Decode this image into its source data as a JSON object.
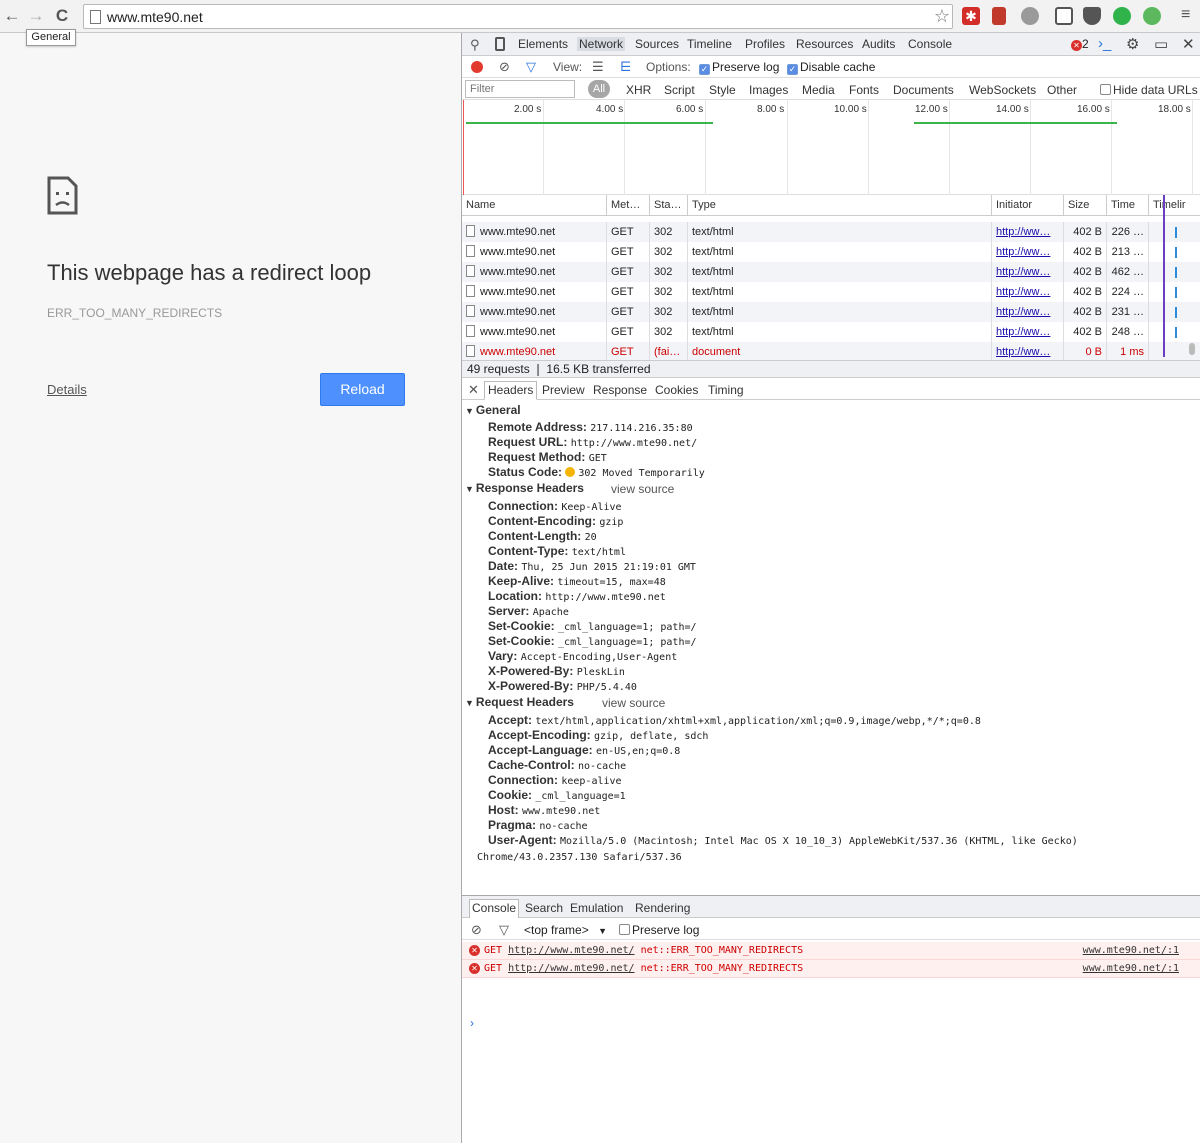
{
  "browser": {
    "url": "www.mte90.net",
    "tooltip": "General",
    "nav": {
      "back": "←",
      "forward": "→",
      "reload": "C"
    },
    "extensions": [
      {
        "name": "bookmark-star-icon",
        "color": "#777777"
      },
      {
        "name": "lastpass-icon",
        "color": "#d32d27"
      },
      {
        "name": "red-book-icon",
        "color": "#c0392b"
      },
      {
        "name": "gray-pen-icon",
        "color": "#9a9a9a"
      },
      {
        "name": "screenshot-icon",
        "color": "#555555"
      },
      {
        "name": "pocket-icon",
        "color": "#555555"
      },
      {
        "name": "green-d-icon",
        "color": "#2fb34a"
      },
      {
        "name": "green-chat-icon",
        "color": "#5cb85c"
      }
    ]
  },
  "error_page": {
    "title": "This webpage has a redirect loop",
    "code": "ERR_TOO_MANY_REDIRECTS",
    "details_label": "Details",
    "reload_label": "Reload",
    "accent": "#4d90fe"
  },
  "devtools": {
    "tabs": [
      "Elements",
      "Network",
      "Sources",
      "Timeline",
      "Profiles",
      "Resources",
      "Audits",
      "Console"
    ],
    "active_tab": "Network",
    "error_count": "2",
    "network_toolbar": {
      "view_label": "View:",
      "options_label": "Options:",
      "preserve_log": "Preserve log",
      "disable_cache": "Disable cache"
    },
    "filter": {
      "placeholder": "Filter",
      "all": "All",
      "types": [
        "XHR",
        "Script",
        "Style",
        "Images",
        "Media",
        "Fonts",
        "Documents",
        "WebSockets",
        "Other"
      ],
      "hide_data_urls": "Hide data URLs"
    },
    "timeline_ticks": [
      "2.00 s",
      "4.00 s",
      "6.00 s",
      "8.00 s",
      "10.00 s",
      "12.00 s",
      "14.00 s",
      "16.00 s",
      "18.00 s"
    ],
    "columns": [
      "Name",
      "Met…",
      "Sta…",
      "Type",
      "Initiator",
      "Size",
      "Time",
      "Timelir"
    ],
    "rows": [
      {
        "name": "www.mte90.net",
        "method": "GET",
        "status": "302",
        "type": "text/html",
        "initiator": "http://ww…",
        "size": "402 B",
        "time": "226 …",
        "failed": false
      },
      {
        "name": "www.mte90.net",
        "method": "GET",
        "status": "302",
        "type": "text/html",
        "initiator": "http://ww…",
        "size": "402 B",
        "time": "213 …",
        "failed": false
      },
      {
        "name": "www.mte90.net",
        "method": "GET",
        "status": "302",
        "type": "text/html",
        "initiator": "http://ww…",
        "size": "402 B",
        "time": "462 …",
        "failed": false
      },
      {
        "name": "www.mte90.net",
        "method": "GET",
        "status": "302",
        "type": "text/html",
        "initiator": "http://ww…",
        "size": "402 B",
        "time": "224 …",
        "failed": false
      },
      {
        "name": "www.mte90.net",
        "method": "GET",
        "status": "302",
        "type": "text/html",
        "initiator": "http://ww…",
        "size": "402 B",
        "time": "231 …",
        "failed": false
      },
      {
        "name": "www.mte90.net",
        "method": "GET",
        "status": "302",
        "type": "text/html",
        "initiator": "http://ww…",
        "size": "402 B",
        "time": "248 …",
        "failed": false
      },
      {
        "name": "www.mte90.net",
        "method": "GET",
        "status": "(fai…",
        "type": "document",
        "initiator": "http://ww…",
        "size": "0 B",
        "time": "1 ms",
        "failed": true
      }
    ],
    "summary": "49 requests  ❘  16.5 KB transferred",
    "detail_tabs": [
      "Headers",
      "Preview",
      "Response",
      "Cookies",
      "Timing"
    ],
    "general": {
      "title": "General",
      "items": [
        {
          "k": "Remote Address:",
          "v": "217.114.216.35:80"
        },
        {
          "k": "Request URL:",
          "v": "http://www.mte90.net/"
        },
        {
          "k": "Request Method:",
          "v": "GET"
        },
        {
          "k": "Status Code:",
          "v": "302 Moved Temporarily"
        }
      ]
    },
    "response_headers": {
      "title": "Response Headers",
      "view_source": "view source",
      "items": [
        {
          "k": "Connection:",
          "v": "Keep-Alive"
        },
        {
          "k": "Content-Encoding:",
          "v": "gzip"
        },
        {
          "k": "Content-Length:",
          "v": "20"
        },
        {
          "k": "Content-Type:",
          "v": "text/html"
        },
        {
          "k": "Date:",
          "v": "Thu, 25 Jun 2015 21:19:01 GMT"
        },
        {
          "k": "Keep-Alive:",
          "v": "timeout=15, max=48"
        },
        {
          "k": "Location:",
          "v": "http://www.mte90.net"
        },
        {
          "k": "Server:",
          "v": "Apache"
        },
        {
          "k": "Set-Cookie:",
          "v": "_cml_language=1; path=/"
        },
        {
          "k": "Set-Cookie:",
          "v": "_cml_language=1; path=/"
        },
        {
          "k": "Vary:",
          "v": "Accept-Encoding,User-Agent"
        },
        {
          "k": "X-Powered-By:",
          "v": "PleskLin"
        },
        {
          "k": "X-Powered-By:",
          "v": "PHP/5.4.40"
        }
      ]
    },
    "request_headers": {
      "title": "Request Headers",
      "view_source": "view source",
      "items": [
        {
          "k": "Accept:",
          "v": "text/html,application/xhtml+xml,application/xml;q=0.9,image/webp,*/*;q=0.8"
        },
        {
          "k": "Accept-Encoding:",
          "v": "gzip, deflate, sdch"
        },
        {
          "k": "Accept-Language:",
          "v": "en-US,en;q=0.8"
        },
        {
          "k": "Cache-Control:",
          "v": "no-cache"
        },
        {
          "k": "Connection:",
          "v": "keep-alive"
        },
        {
          "k": "Cookie:",
          "v": "_cml_language=1"
        },
        {
          "k": "Host:",
          "v": "www.mte90.net"
        },
        {
          "k": "Pragma:",
          "v": "no-cache"
        },
        {
          "k": "User-Agent:",
          "v": "Mozilla/5.0 (Macintosh; Intel Mac OS X 10_10_3) AppleWebKit/537.36 (KHTML, like Gecko) Chrome/43.0.2357.130 Safari/537.36"
        }
      ]
    },
    "drawer": {
      "tabs": [
        "Console",
        "Search",
        "Emulation",
        "Rendering"
      ],
      "frame": "<top frame>",
      "preserve_log": "Preserve log",
      "messages": [
        {
          "method": "GET",
          "url": "http://www.mte90.net/",
          "error": "net::ERR_TOO_MANY_REDIRECTS",
          "source": "www.mte90.net/:1"
        },
        {
          "method": "GET",
          "url": "http://www.mte90.net/",
          "error": "net::ERR_TOO_MANY_REDIRECTS",
          "source": "www.mte90.net/:1"
        }
      ],
      "prompt": "›"
    }
  }
}
